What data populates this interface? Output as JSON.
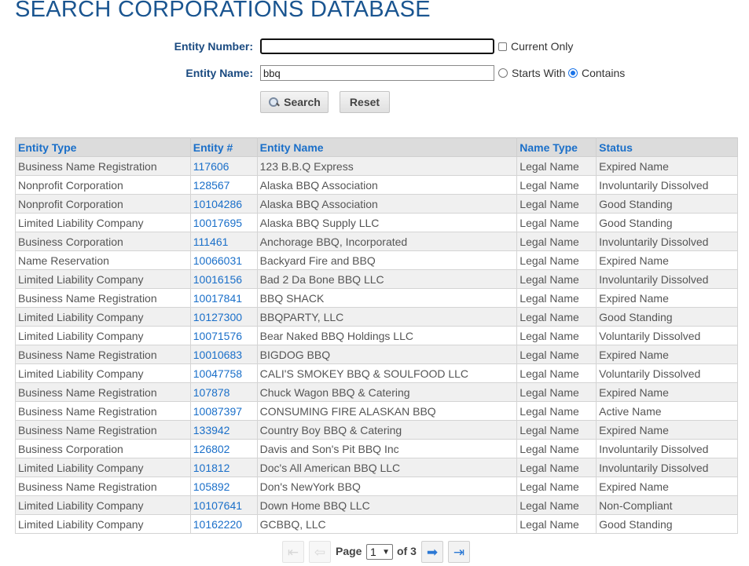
{
  "title": "SEARCH CORPORATIONS DATABASE",
  "form": {
    "entity_number_label": "Entity Number:",
    "entity_number_value": "",
    "current_only_label": "Current Only",
    "entity_name_label": "Entity Name:",
    "entity_name_value": "bbq",
    "starts_with_label": "Starts With",
    "contains_label": "Contains",
    "selected_match": "Contains",
    "search_button": "Search",
    "reset_button": "Reset"
  },
  "table": {
    "headers": [
      "Entity Type",
      "Entity #",
      "Entity Name",
      "Name Type",
      "Status"
    ],
    "rows": [
      [
        "Business Name Registration",
        "117606",
        "123 B.B.Q Express",
        "Legal Name",
        "Expired Name"
      ],
      [
        "Nonprofit Corporation",
        "128567",
        "Alaska BBQ Association",
        "Legal Name",
        "Involuntarily Dissolved"
      ],
      [
        "Nonprofit Corporation",
        "10104286",
        "Alaska BBQ Association",
        "Legal Name",
        "Good Standing"
      ],
      [
        "Limited Liability Company",
        "10017695",
        "Alaska BBQ Supply LLC",
        "Legal Name",
        "Good Standing"
      ],
      [
        "Business Corporation",
        "111461",
        "Anchorage BBQ, Incorporated",
        "Legal Name",
        "Involuntarily Dissolved"
      ],
      [
        "Name Reservation",
        "10066031",
        "Backyard Fire and BBQ",
        "Legal Name",
        "Expired Name"
      ],
      [
        "Limited Liability Company",
        "10016156",
        "Bad 2 Da Bone BBQ LLC",
        "Legal Name",
        "Involuntarily Dissolved"
      ],
      [
        "Business Name Registration",
        "10017841",
        "BBQ SHACK",
        "Legal Name",
        "Expired Name"
      ],
      [
        "Limited Liability Company",
        "10127300",
        "BBQPARTY, LLC",
        "Legal Name",
        "Good Standing"
      ],
      [
        "Limited Liability Company",
        "10071576",
        "Bear Naked BBQ Holdings LLC",
        "Legal Name",
        "Voluntarily Dissolved"
      ],
      [
        "Business Name Registration",
        "10010683",
        "BIGDOG BBQ",
        "Legal Name",
        "Expired Name"
      ],
      [
        "Limited Liability Company",
        "10047758",
        "CALI'S SMOKEY BBQ & SOULFOOD LLC",
        "Legal Name",
        "Voluntarily Dissolved"
      ],
      [
        "Business Name Registration",
        "107878",
        "Chuck Wagon BBQ & Catering",
        "Legal Name",
        "Expired Name"
      ],
      [
        "Business Name Registration",
        "10087397",
        "CONSUMING FIRE ALASKAN BBQ",
        "Legal Name",
        "Active Name"
      ],
      [
        "Business Name Registration",
        "133942",
        "Country Boy BBQ & Catering",
        "Legal Name",
        "Expired Name"
      ],
      [
        "Business Corporation",
        "126802",
        "Davis and Son's Pit BBQ Inc",
        "Legal Name",
        "Involuntarily Dissolved"
      ],
      [
        "Limited Liability Company",
        "101812",
        "Doc's All American BBQ LLC",
        "Legal Name",
        "Involuntarily Dissolved"
      ],
      [
        "Business Name Registration",
        "105892",
        "Don's NewYork BBQ",
        "Legal Name",
        "Expired Name"
      ],
      [
        "Limited Liability Company",
        "10107641",
        "Down Home BBQ LLC",
        "Legal Name",
        "Non-Compliant"
      ],
      [
        "Limited Liability Company",
        "10162220",
        "GCBBQ, LLC",
        "Legal Name",
        "Good Standing"
      ]
    ]
  },
  "pager": {
    "page_label": "Page",
    "current_page": "1",
    "of_label": "of 3",
    "first_icon": "first-page-icon",
    "prev_icon": "previous-page-icon",
    "next_icon": "next-page-icon",
    "last_icon": "last-page-icon"
  },
  "colors": {
    "title": "#1a5590",
    "header_link": "#1a6fc9",
    "row_alt": "#f0f0f0"
  }
}
